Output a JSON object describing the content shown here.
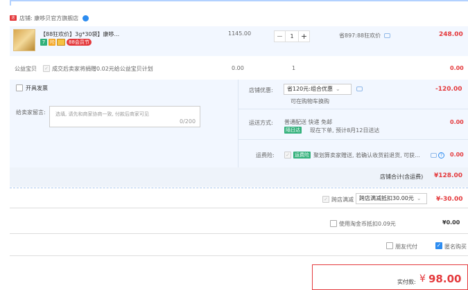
{
  "shop": {
    "label": "店铺: 康哆贝官方旗舰店"
  },
  "item": {
    "title": "【88狂欢价】3g*30袋】康哆...",
    "badges": [
      "7",
      "险"
    ],
    "promo_badge": "88会员节",
    "unit_price": "1145.00",
    "quantity": "1",
    "savings": "省897:88狂欢价",
    "subtotal": "248.00"
  },
  "charity": {
    "label": "公益宝贝",
    "text": "成交后卖家将捐赠0.02元给公益宝贝计划",
    "price": "0.00",
    "qty": "1",
    "total": "0.00"
  },
  "invoice": {
    "label": "开具发票"
  },
  "discount": {
    "label": "店铺优惠:",
    "selected": "省120元:组合优惠",
    "sub": "可在购物车换购",
    "amount": "-120.00"
  },
  "message": {
    "label": "给卖家留言:",
    "placeholder": "选填, 请先和商家协商一致, 付款后商家可见",
    "counter": "0/200"
  },
  "shipping": {
    "label": "运送方式:",
    "method": "普通配送 快递 免邮",
    "tag": "隔日达",
    "eta": "现在下单, 预计8月12日送达",
    "amount": "0.00"
  },
  "insurance": {
    "label": "运费险:",
    "tag": "运费险",
    "text": "聚划算卖家赠送, 若确认收货前退货, 可获...",
    "amount": "0.00"
  },
  "shop_total": {
    "label": "店铺合计(含运费)",
    "amount": "¥128.00"
  },
  "cross_store": {
    "label": "跨店满减",
    "selected": "跨店满减抵扣30.00元",
    "amount": "¥-30.00"
  },
  "gold_coin": {
    "label": "使用淘金币抵扣0.09元",
    "amount": "¥0.00"
  },
  "pay_options": {
    "friend_pay": "朋友代付",
    "anonymous": "匿名购买"
  },
  "final": {
    "label": "实付款:",
    "currency": "¥",
    "amount": "98.00"
  },
  "colors": {
    "accent_red": "#e4393c",
    "highlight_blue": "#f2f7ff",
    "link_blue": "#2d8cf0"
  }
}
